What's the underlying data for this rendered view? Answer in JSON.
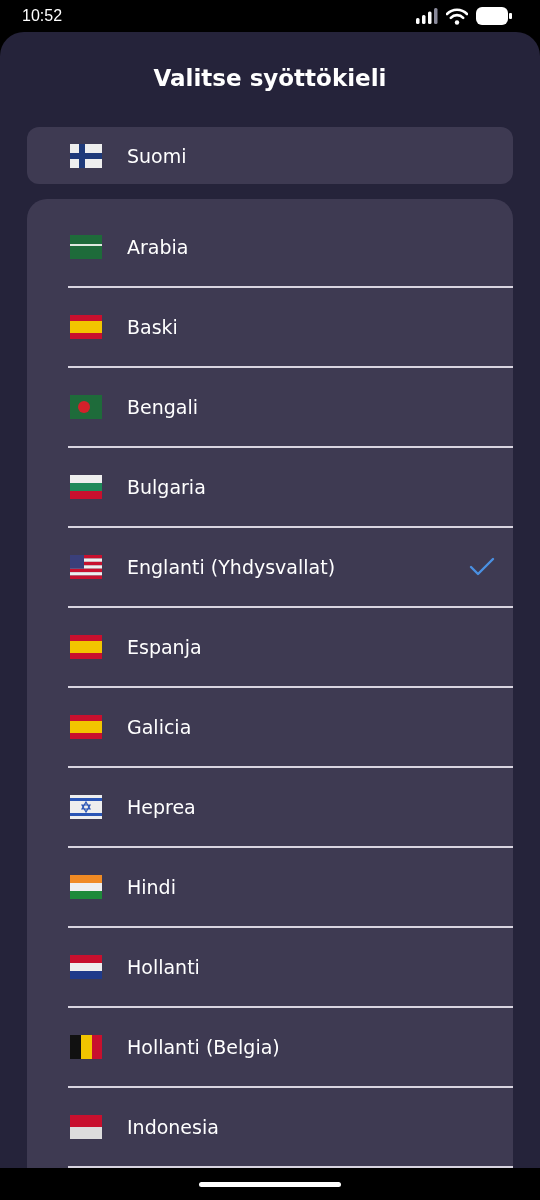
{
  "status_bar": {
    "time": "10:52"
  },
  "title": "Valitse syöttökieli",
  "current": {
    "label": "Suomi",
    "kind": "finland"
  },
  "languages": [
    {
      "label": "Arabia",
      "kind": "saudi",
      "selected": false
    },
    {
      "label": "Baski",
      "kind": "spain",
      "selected": false
    },
    {
      "label": "Bengali",
      "kind": "bangladesh",
      "selected": false
    },
    {
      "label": "Bulgaria",
      "kind": "bulgaria",
      "selected": false
    },
    {
      "label": "Englanti (Yhdysvallat)",
      "kind": "usa",
      "selected": true
    },
    {
      "label": "Espanja",
      "kind": "spain",
      "selected": false
    },
    {
      "label": "Galicia",
      "kind": "spain",
      "selected": false
    },
    {
      "label": "Heprea",
      "kind": "israel",
      "selected": false
    },
    {
      "label": "Hindi",
      "kind": "india",
      "selected": false
    },
    {
      "label": "Hollanti",
      "kind": "netherlands",
      "selected": false
    },
    {
      "label": "Hollanti (Belgia)",
      "kind": "belgium",
      "selected": false
    },
    {
      "label": "Indonesia",
      "kind": "indonesia",
      "selected": false
    }
  ]
}
